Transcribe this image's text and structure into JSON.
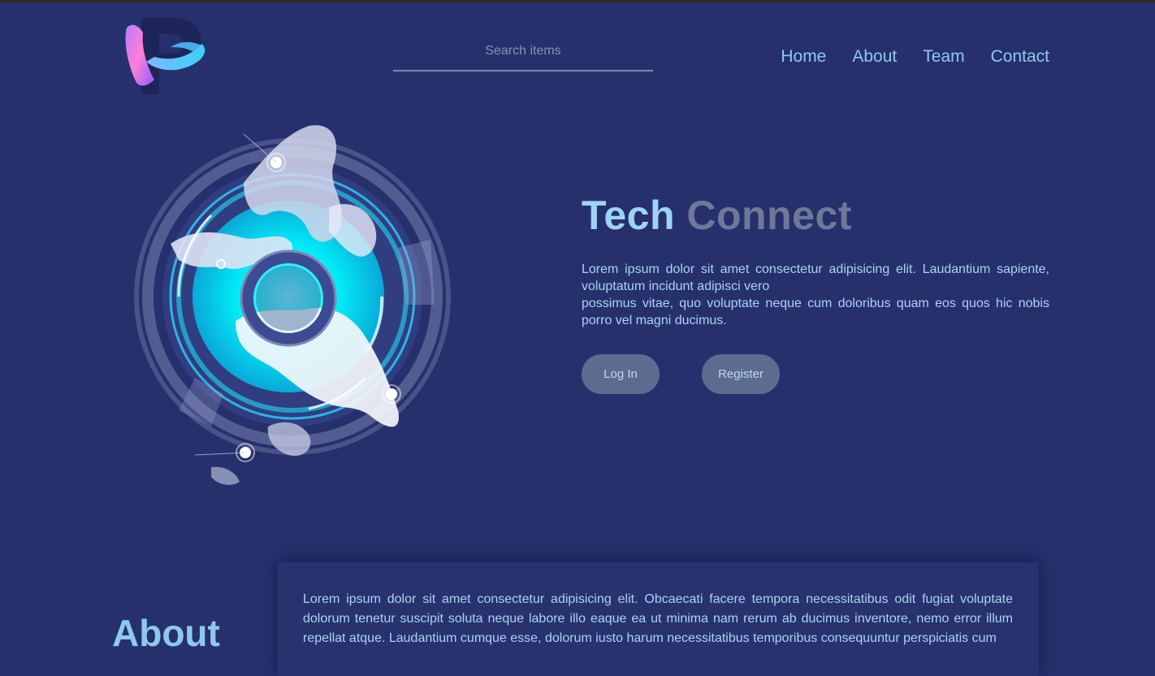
{
  "header": {
    "logo_alt": "Logo",
    "search": {
      "placeholder": "Search items",
      "value": ""
    },
    "nav": [
      {
        "label": "Home"
      },
      {
        "label": "About"
      },
      {
        "label": "Team"
      },
      {
        "label": "Contact"
      }
    ]
  },
  "hero": {
    "title_part1": "Tech",
    "title_part2": "Connect",
    "description_line1": "Lorem ipsum dolor sit amet consectetur adipisicing elit. Laudantium sapiente, voluptatum incidunt adipisci vero",
    "description_line2": "possimus vitae, quo voluptate neque cum doloribus quam eos quos hic nobis porro vel magni ducimus.",
    "login_label": "Log In",
    "register_label": "Register"
  },
  "about": {
    "heading": "About",
    "text": "Lorem ipsum dolor sit amet consectetur adipisicing elit. Obcaecati facere tempora necessitatibus odit fugiat voluptate dolorum tenetur suscipit soluta neque labore illo eaque ea ut minima nam rerum ab ducimus inventore, nemo error illum repellat atque. Laudantium cumque esse, dolorum iusto harum necessitatibus temporibus consequuntur perspiciatis cum"
  },
  "colors": {
    "background": "#26306c",
    "accent": "#8fc8ee",
    "button": "#5f6a90",
    "globe_cyan": "#00e8f5"
  }
}
